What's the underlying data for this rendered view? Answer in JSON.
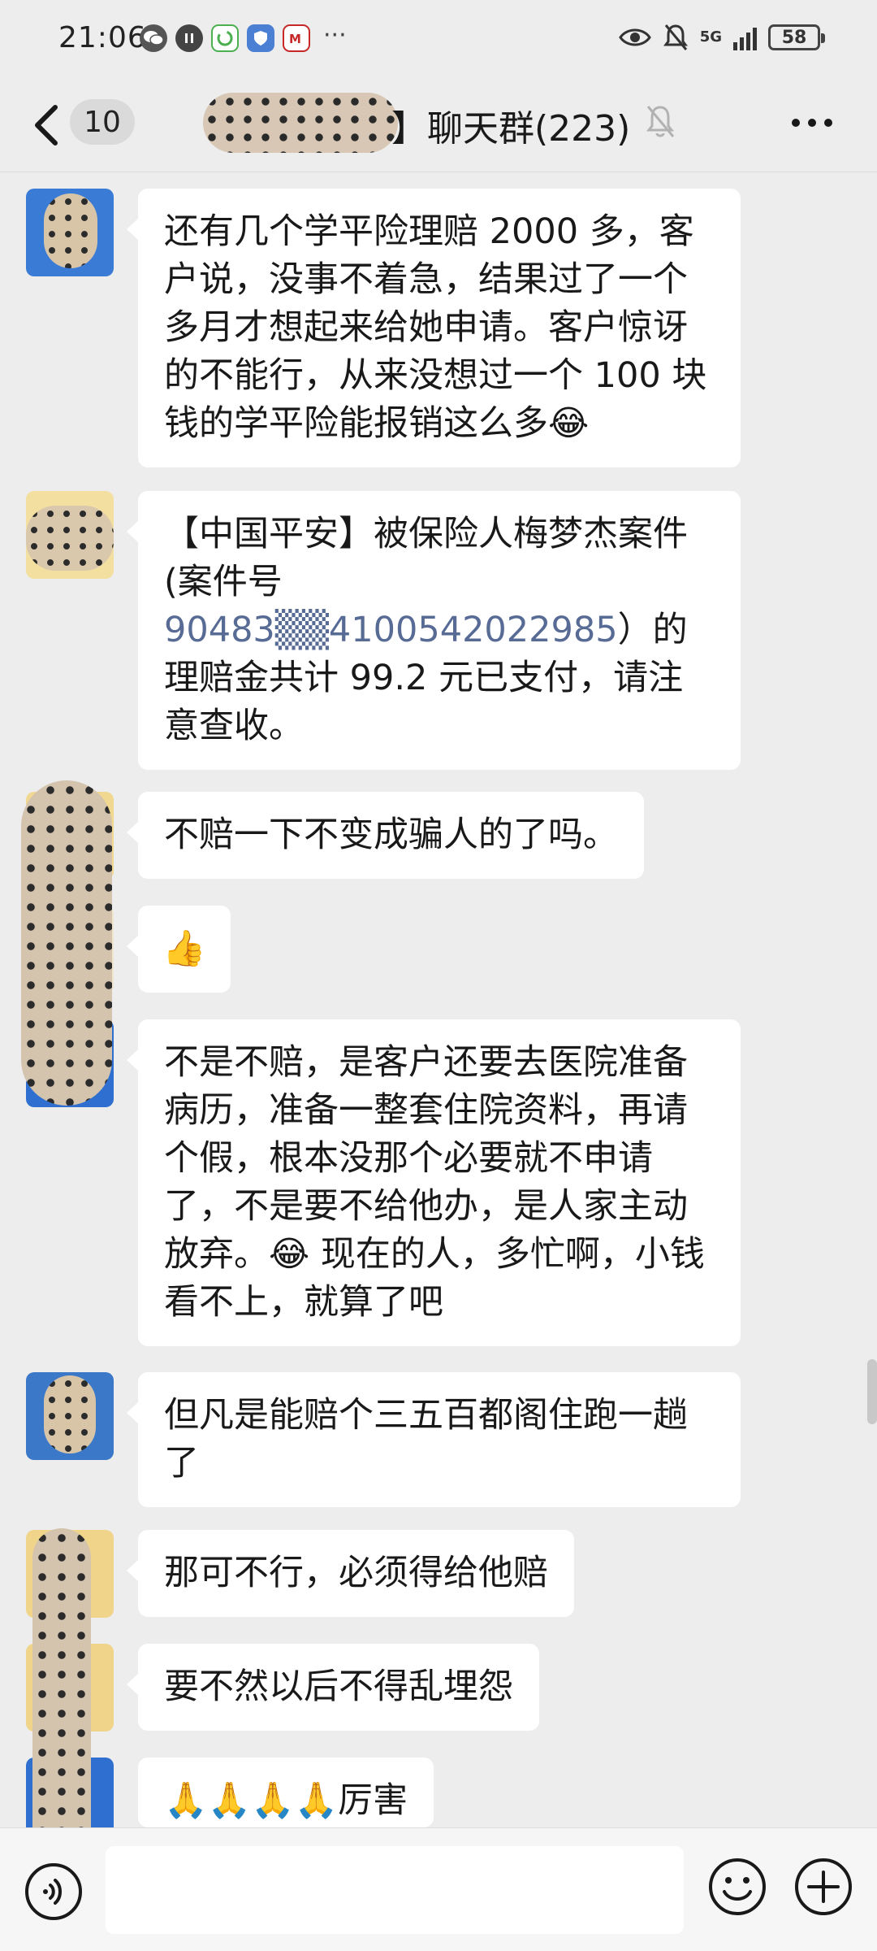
{
  "status_bar": {
    "time": "21:06",
    "network": "5G",
    "battery": "58",
    "more": "···",
    "icons": [
      "wechat-icon",
      "app-icon",
      "sync-icon",
      "shield-app-icon",
      "bank-app-icon",
      "eye-icon",
      "bell-off-icon",
      "signal-icon",
      "battery-icon"
    ]
  },
  "header": {
    "back_count": "10",
    "title": "】聊天群(223)",
    "icons": [
      "back-icon",
      "mute-icon",
      "more-icon"
    ]
  },
  "messages": [
    {
      "text": "还有几个学平险理赔 2000 多，客户说，没事不着急，结果过了一个多月才想起来给她申请。客户惊讶的不能行，从来没想过一个 100 块钱的学平险能报销这么多",
      "emoji": "😂"
    },
    {
      "before": "【中国平安】被保险人梅梦杰案件(案件号 ",
      "link": "90483▒▒4100542022985",
      "after": "）的理赔金共计 99.2 元已支付，请注意查收。"
    },
    {
      "text": "不赔一下不变成骗人的了吗。"
    },
    {
      "emoji": "👍"
    },
    {
      "text1": "不是不赔，是客户还要去医院准备病历，准备一整套住院资料，再请个假，根本没那个必要就不申请了，不是要不给他办，是人家主动放弃。",
      "emoji": "😂",
      "text2": " 现在的人，多忙啊，小钱看不上，就算了吧"
    },
    {
      "text": "但凡是能赔个三五百都阁住跑一趟了"
    },
    {
      "text": "那可不行，必须得给他赔"
    },
    {
      "text": "要不然以后不得乱埋怨"
    },
    {
      "emoji": "🙏🙏🙏🙏",
      "text": "厉害"
    }
  ],
  "input_bar": {
    "placeholder": "",
    "icons": [
      "voice-icon",
      "emoji-icon",
      "plus-icon"
    ]
  }
}
